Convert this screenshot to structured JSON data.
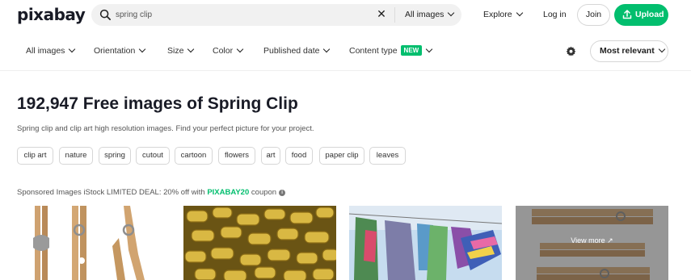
{
  "header": {
    "logo": "pixabay",
    "search_value": "spring clip",
    "clear_symbol": "✕",
    "search_type": "All images",
    "explore": "Explore",
    "login": "Log in",
    "join": "Join",
    "upload": "Upload"
  },
  "filters": {
    "all_images": "All images",
    "orientation": "Orientation",
    "size": "Size",
    "color": "Color",
    "published_date": "Published date",
    "content_type": "Content type",
    "new_badge": "NEW",
    "sort": "Most relevant"
  },
  "main": {
    "title": "192,947 Free images of Spring Clip",
    "subtitle": "Spring clip and clip art high resolution images. Find your perfect picture for your project.",
    "tags": [
      "clip art",
      "nature",
      "spring",
      "cutout",
      "cartoon",
      "flowers",
      "art",
      "food",
      "paper clip",
      "leaves"
    ],
    "sponsored_prefix": "Sponsored Images iStock LIMITED DEAL: 20% off with ",
    "sponsored_code": "PIXABAY20",
    "sponsored_suffix": " coupon",
    "info_symbol": "i",
    "view_more": "View more ↗"
  },
  "colors": {
    "brand_green": "#02be6e",
    "text_dark": "#191b26"
  },
  "icons": [
    "search-icon",
    "close-icon",
    "chevron-down-icon",
    "upload-icon",
    "gear-icon",
    "info-icon"
  ]
}
